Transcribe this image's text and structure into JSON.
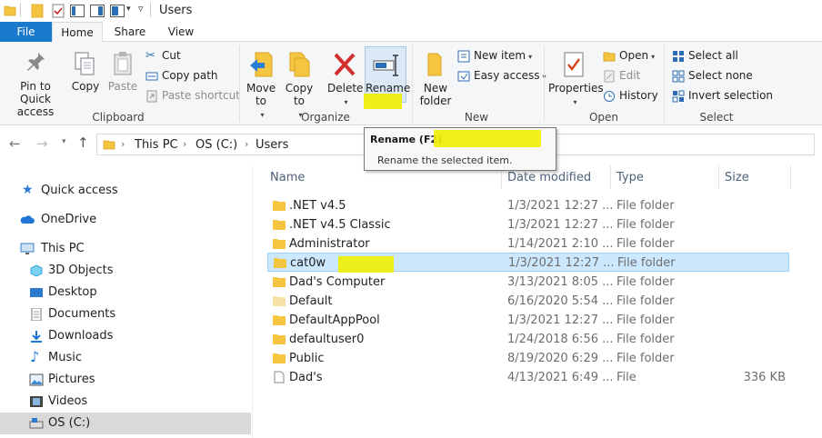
{
  "window": {
    "title": "Users"
  },
  "ribbon_tabs": [
    {
      "label": "File"
    },
    {
      "label": "Home"
    },
    {
      "label": "Share"
    },
    {
      "label": "View"
    }
  ],
  "clipboard": {
    "pin_label": "Pin to Quick access",
    "copy_label": "Copy",
    "paste_label": "Paste",
    "cut_label": "Cut",
    "copy_path_label": "Copy path",
    "paste_shortcut_label": "Paste shortcut",
    "group_label": "Clipboard"
  },
  "organize": {
    "move_to_label": "Move to",
    "copy_to_label": "Copy to",
    "delete_label": "Delete",
    "rename_label": "Rename",
    "group_label": "Organize"
  },
  "new": {
    "new_folder_label": "New folder",
    "new_item_label": "New item",
    "easy_access_label": "Easy access",
    "group_label": "New"
  },
  "open": {
    "properties_label": "Properties",
    "open_label": "Open",
    "edit_label": "Edit",
    "history_label": "History",
    "group_label": "Open"
  },
  "select": {
    "select_all_label": "Select all",
    "select_none_label": "Select none",
    "invert_label": "Invert selection",
    "group_label": "Select"
  },
  "address": {
    "crumbs": [
      "This PC",
      "OS (C:)",
      "Users"
    ]
  },
  "tooltip": {
    "title": "Rename (F2)",
    "description": "Rename the selected item."
  },
  "nav_pane": {
    "items": [
      {
        "label": "Quick access",
        "icon": "star-icon"
      },
      {
        "label": "OneDrive",
        "icon": "cloud-icon"
      },
      {
        "label": "This PC",
        "icon": "computer-icon"
      },
      {
        "label": "3D Objects",
        "icon": "cube-icon"
      },
      {
        "label": "Desktop",
        "icon": "desktop-icon"
      },
      {
        "label": "Documents",
        "icon": "documents-icon"
      },
      {
        "label": "Downloads",
        "icon": "download-icon"
      },
      {
        "label": "Music",
        "icon": "music-icon"
      },
      {
        "label": "Pictures",
        "icon": "pictures-icon"
      },
      {
        "label": "Videos",
        "icon": "videos-icon"
      },
      {
        "label": "OS (C:)",
        "icon": "drive-icon"
      }
    ]
  },
  "file_list": {
    "columns": {
      "name": "Name",
      "date": "Date modified",
      "type": "Type",
      "size": "Size"
    },
    "rows": [
      {
        "name": ".NET v4.5",
        "date": "1/3/2021 12:27 ...",
        "type": "File folder",
        "size": ""
      },
      {
        "name": ".NET v4.5 Classic",
        "date": "1/3/2021 12:27 ...",
        "type": "File folder",
        "size": ""
      },
      {
        "name": "Administrator",
        "date": "1/14/2021 2:10 ...",
        "type": "File folder",
        "size": ""
      },
      {
        "name": "cat0w",
        "date": "1/3/2021 12:27 ...",
        "type": "File folder",
        "size": ""
      },
      {
        "name": "Dad's Computer",
        "date": "3/13/2021 8:05 ...",
        "type": "File folder",
        "size": ""
      },
      {
        "name": "Default",
        "date": "6/16/2020 5:54 ...",
        "type": "File folder",
        "size": ""
      },
      {
        "name": "DefaultAppPool",
        "date": "1/3/2021 12:27 ...",
        "type": "File folder",
        "size": ""
      },
      {
        "name": "defaultuser0",
        "date": "1/24/2018 6:56 ...",
        "type": "File folder",
        "size": ""
      },
      {
        "name": "Public",
        "date": "8/19/2020 6:29 ...",
        "type": "File folder",
        "size": ""
      },
      {
        "name": "Dad's",
        "date": "4/13/2021 6:49 ...",
        "type": "File",
        "size": "336 KB"
      }
    ]
  },
  "colors": {
    "accent": "#1979ca",
    "selection": "#cce8ff",
    "highlight": "#f0f000",
    "folder": "#f5c542"
  }
}
